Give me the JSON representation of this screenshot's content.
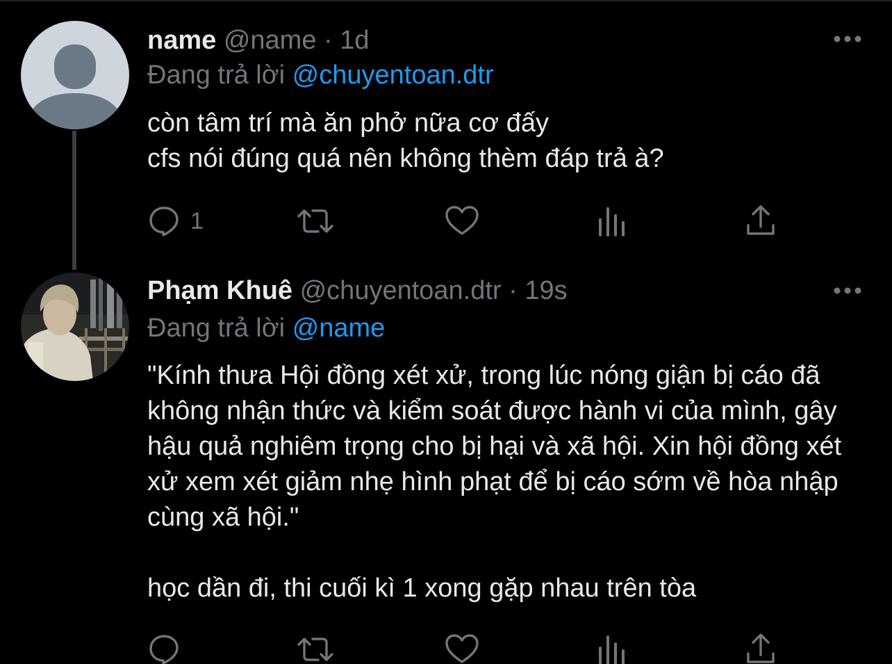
{
  "tweets": [
    {
      "display_name": "name",
      "handle": "@name",
      "separator": "·",
      "time": "1d",
      "reply_prefix": "Đang trả lời",
      "reply_to": "@chuyentoan.dtr",
      "text": "còn tâm trí mà ăn phở nữa cơ đấy\ncfs nói đúng quá nên không thèm đáp trả à?",
      "reply_count": "1",
      "icons": [
        "more-dots-icon",
        "reply-bubble-icon",
        "retweet-icon",
        "heart-icon",
        "views-bars-icon",
        "share-icon"
      ]
    },
    {
      "display_name": "Phạm Khuê",
      "handle": "@chuyentoan.dtr",
      "separator": "·",
      "time": "19s",
      "reply_prefix": "Đang trả lời",
      "reply_to": "@name",
      "text": "\"Kính thưa Hội đồng xét xử, trong lúc nóng giận bị cáo đã không nhận thức và kiểm soát được hành vi của mình, gây hậu quả nghiêm trọng cho bị hại và xã hội. Xin hội đồng xét xử xem xét giảm nhẹ hình phạt để bị cáo sớm về hòa nhập cùng xã hội.\"\n\nhọc dần đi, thi cuối kì 1 xong gặp nhau trên tòa",
      "reply_count": "",
      "icons": [
        "more-dots-icon",
        "reply-bubble-icon",
        "retweet-icon",
        "heart-icon",
        "views-bars-icon",
        "share-icon"
      ]
    }
  ],
  "colors": {
    "background": "#000000",
    "text": "#E7E9EA",
    "muted": "#71767B",
    "accent": "#1D9BF0",
    "thread_line": "#3A3F44"
  }
}
